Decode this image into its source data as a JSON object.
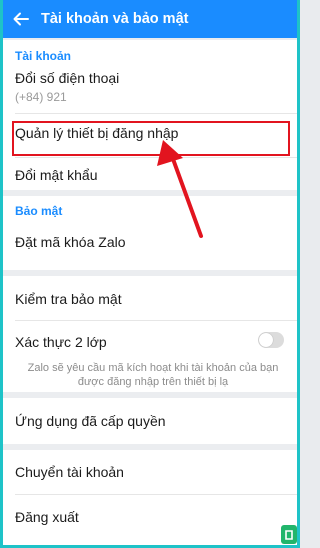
{
  "header": {
    "title": "Tài khoản và bảo mật",
    "back_icon": "arrow-left-icon",
    "background": "#1a8cff"
  },
  "account_section": {
    "title": "Tài khoản",
    "items": [
      {
        "label": "Đổi số điện thoại",
        "sub": "(+84) 921"
      },
      {
        "label": "Quản lý thiết bị đăng nhập"
      },
      {
        "label": "Đổi mật khẩu"
      }
    ]
  },
  "security_section": {
    "title": "Bảo mật",
    "items": [
      {
        "label": "Đặt mã khóa Zalo"
      }
    ]
  },
  "check_section": {
    "items": [
      {
        "label": "Kiểm tra bảo mật"
      },
      {
        "label": "Xác thực 2 lớp",
        "description": "Zalo sẽ yêu cầu mã kích hoạt khi tài khoản của bạn được đăng nhập trên thiết bị lạ",
        "toggle_on": false
      }
    ]
  },
  "apps_section": {
    "items": [
      {
        "label": "Ứng dụng đã cấp quyền"
      }
    ]
  },
  "account_actions": {
    "items": [
      {
        "label": "Chuyển tài khoản"
      },
      {
        "label": "Đăng xuất"
      }
    ]
  },
  "colors": {
    "accent": "#1a8cff",
    "annotation": "#e2141f",
    "frame": "#1ec3c8"
  }
}
